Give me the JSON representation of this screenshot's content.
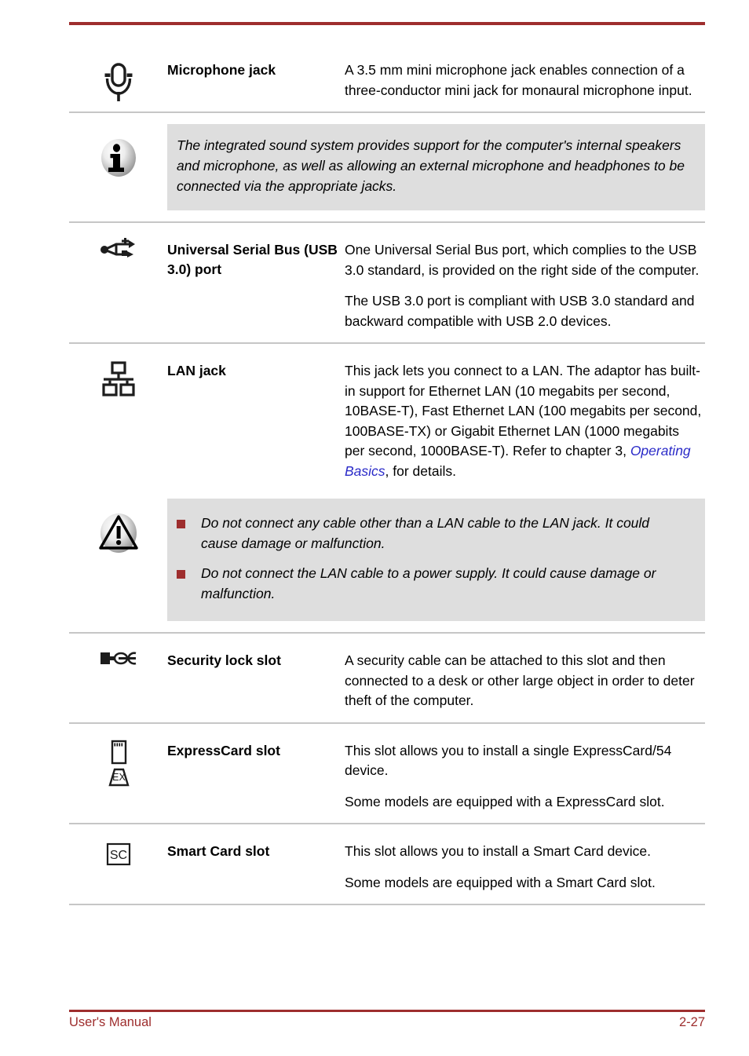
{
  "document": {
    "accent_color": "#9e2e2e",
    "link_color": "#2b2bc8",
    "callout_bg": "#dedede"
  },
  "footer": {
    "left_label": "User's Manual",
    "page_number": "2-27"
  },
  "sections": [
    {
      "id": "microphone-jack",
      "icon": "microphone-icon",
      "term": "Microphone jack",
      "paragraphs": [
        "A 3.5 mm mini microphone jack enables connection of a three-conductor mini jack for monaural microphone input."
      ]
    },
    {
      "id": "sound-system-note",
      "type": "note",
      "icon": "info-icon",
      "text": "The integrated sound system provides support for the computer's internal speakers and microphone, as well as allowing an external microphone and headphones to be connected via the appropriate jacks."
    },
    {
      "id": "usb-port",
      "icon": "usb-icon",
      "term": "Universal Serial Bus (USB 3.0) port",
      "paragraphs": [
        "One Universal Serial Bus port, which complies to the USB 3.0 standard, is provided on the right side of the computer.",
        "The USB 3.0 port is compliant with USB 3.0 standard and backward compatible with USB 2.0 devices."
      ]
    },
    {
      "id": "lan-jack",
      "icon": "lan-icon",
      "term": "LAN jack",
      "paragraph_lead": "This jack lets you connect to a LAN. The adaptor has built-in support for Ethernet LAN (10 megabits per second, 10BASE-T), Fast Ethernet LAN (100 megabits per second, 100BASE-TX) or Gigabit Ethernet LAN (1000 megabits per second, 1000BASE-T). Refer to chapter 3, ",
      "link_text": "Operating Basics",
      "paragraph_tail": ", for details."
    },
    {
      "id": "lan-warning",
      "type": "warning",
      "icon": "warning-triangle-icon",
      "bullets": [
        "Do not connect any cable other than a LAN cable to the LAN jack. It could cause damage or malfunction.",
        "Do not connect the LAN cable to a power supply. It could cause damage or malfunction."
      ]
    },
    {
      "id": "security-lock-slot",
      "icon": "security-lock-icon",
      "term": "Security lock slot",
      "paragraphs": [
        "A security cable can be attached to this slot and then connected to a desk or other large object in order to deter theft of the computer."
      ]
    },
    {
      "id": "expresscard-slot",
      "icon": "expresscard-icon",
      "icon_label": "EX",
      "term": "ExpressCard slot",
      "paragraphs": [
        "This slot allows you to install a single ExpressCard/54 device.",
        "Some models are equipped with a ExpressCard slot."
      ]
    },
    {
      "id": "smart-card-slot",
      "icon": "smart-card-icon",
      "icon_label": "SC",
      "term": "Smart Card slot",
      "paragraphs": [
        "This slot allows you to install a Smart Card device.",
        "Some models are equipped with a Smart Card slot."
      ]
    }
  ]
}
